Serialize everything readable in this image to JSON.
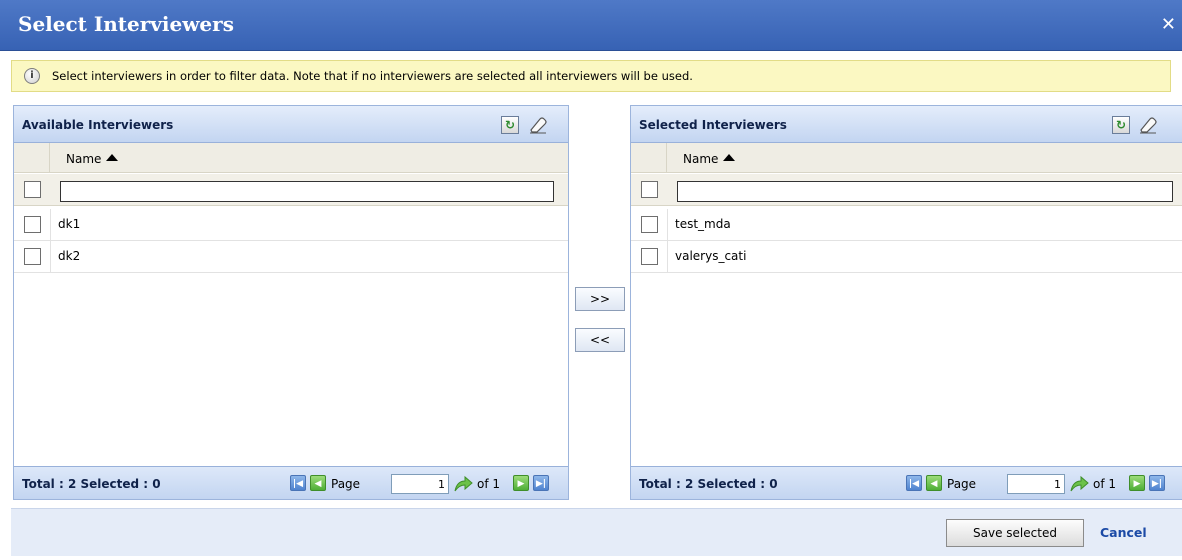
{
  "dialog": {
    "title": "Select Interviewers",
    "close_icon": "✕"
  },
  "info": {
    "icon": "info-icon",
    "text": "Select interviewers in order to filter data. Note that if no interviewers are selected all interviewers will be used."
  },
  "available": {
    "title": "Available Interviewers",
    "column": "Name",
    "filter_value": "",
    "rows": [
      "dk1",
      "dk2"
    ],
    "totals": "Total : 2 Selected : 0",
    "page_label": "Page",
    "page_value": "1",
    "of_label": "of 1"
  },
  "selected": {
    "title": "Selected Interviewers",
    "column": "Name",
    "filter_value": "",
    "rows": [
      "test_mda",
      "valerys_cati"
    ],
    "totals": "Total : 2 Selected : 0",
    "page_label": "Page",
    "page_value": "1",
    "of_label": "of 1"
  },
  "move": {
    "add_label": ">>",
    "remove_label": "<<"
  },
  "actions": {
    "save_label": "Save selected",
    "cancel_label": "Cancel"
  },
  "colors": {
    "titlebar": "#3762b4",
    "info_bg": "#fbf8c2",
    "panel_header": "#c3d5f1",
    "link": "#1b4aa6"
  }
}
